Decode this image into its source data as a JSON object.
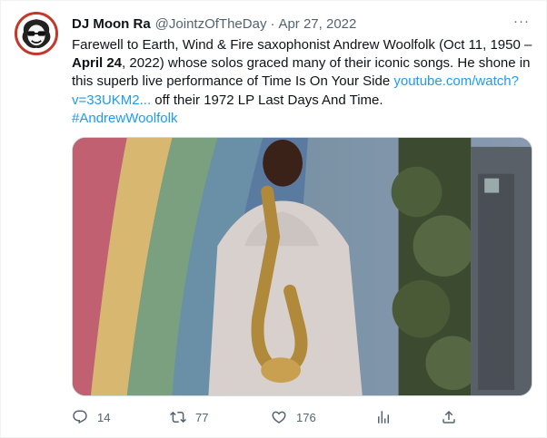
{
  "tweet": {
    "display_name": "DJ Moon Ra",
    "handle": "@JointzOfTheDay",
    "separator": "·",
    "date": "Apr 27, 2022",
    "more_label": "···",
    "text_part1": "Farewell to Earth, Wind & Fire saxophonist Andrew Woolfolk (Oct 11, 1950 – ",
    "text_bold": "April 24",
    "text_part2": ", 2022) whose solos graced many of their iconic songs. He shone in this superb live performance of Time Is On Your Side ",
    "link_text": "youtube.com/watch?v=33UKM2...",
    "text_part3": " off their 1972 LP Last Days And Time.",
    "hashtag": "#AndrewWoolfolk"
  },
  "actions": {
    "reply_count": "14",
    "retweet_count": "77",
    "like_count": "176"
  },
  "colors": {
    "link": "#1d9bf0",
    "secondary_text": "#536471",
    "primary_text": "#0f1419"
  },
  "icons": [
    "reply-icon",
    "retweet-icon",
    "like-icon",
    "analytics-icon",
    "share-icon",
    "more-icon"
  ]
}
